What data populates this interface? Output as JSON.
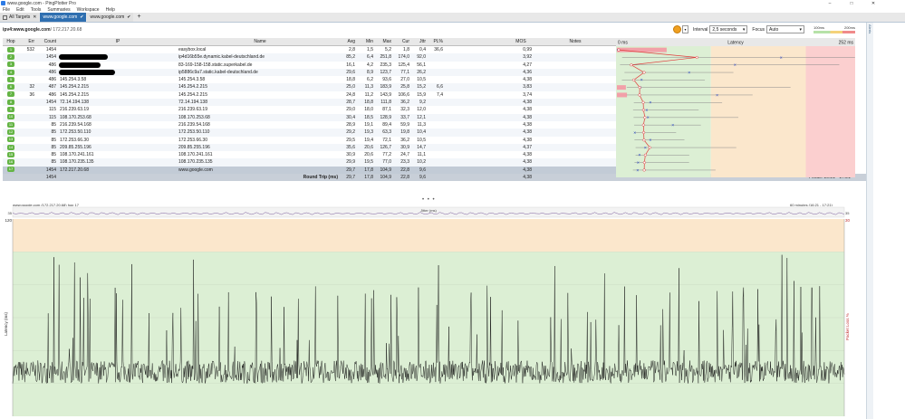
{
  "window": {
    "title": "www.google.com - PingPlotter Pro",
    "controls": [
      "–",
      "□",
      "✕"
    ]
  },
  "menu": [
    "File",
    "Edit",
    "Tools",
    "Summaries",
    "Workspace",
    "Help"
  ],
  "tabs": [
    {
      "label": "All Targets",
      "icon": "✕",
      "active": false
    },
    {
      "label": "www.google.com",
      "icon": "✔",
      "active": true
    },
    {
      "label": "www.google.com",
      "icon": "✔",
      "active": false
    }
  ],
  "add_tab": "+",
  "target": {
    "name": "ipv4:www.google.com",
    "ip": " / 172.217.20.68"
  },
  "controls": {
    "interval_label": "Interval",
    "interval_value": "2,5 seconds",
    "focus_label": "Focus",
    "focus_value": "Auto",
    "threshold_low": "100ms",
    "threshold_high": "200ms"
  },
  "sidebar": {
    "alerts_label": "Alerts"
  },
  "columns": {
    "hop": "Hop",
    "err": "Err",
    "count": "Count",
    "ip": "IP",
    "name": "Name",
    "avg": "Avg",
    "min": "Min",
    "max": "Max",
    "cur": "Cur",
    "jttr": "Jttr",
    "pl": "PL%",
    "mos": "MOS",
    "notes": "Notes",
    "latency": "Latency",
    "latency_min": "0 ms",
    "latency_max": "252 ms"
  },
  "hops": [
    {
      "hop": "1",
      "err": "532",
      "count": "1454",
      "ip": "",
      "name": "easybox.local",
      "avg": "2,8",
      "min": "1,5",
      "max": "5,2",
      "cur": "1,8",
      "jttr": "0,4",
      "pl": "36,6",
      "mos": "0,99"
    },
    {
      "hop": "2",
      "err": "",
      "count": "1454",
      "ip": "",
      "name": "ip4d16b55e.dynamic.kabel-deutschland.de",
      "avg": "85,2",
      "min": "6,4",
      "max": "251,8",
      "cur": "174,0",
      "jttr": "92,0",
      "pl": "",
      "mos": "3,92"
    },
    {
      "hop": "3",
      "err": "",
      "count": "486",
      "ip": "",
      "name": "83-169-158-158.static.superkabel.de",
      "avg": "16,1",
      "min": "4,2",
      "max": "235,3",
      "cur": "125,4",
      "jttr": "56,1",
      "pl": "",
      "mos": "4,27"
    },
    {
      "hop": "4",
      "err": "",
      "count": "486",
      "ip": "",
      "name": "ip5886c9a7.static.kabel-deutschland.de",
      "avg": "29,6",
      "min": "8,9",
      "max": "123,7",
      "cur": "77,1",
      "jttr": "26,2",
      "pl": "",
      "mos": "4,36"
    },
    {
      "hop": "5",
      "err": "",
      "count": "486",
      "ip": "145.254.3.58",
      "name": "145.254.3.58",
      "avg": "18,8",
      "min": "6,2",
      "max": "93,6",
      "cur": "27,0",
      "jttr": "10,5",
      "pl": "",
      "mos": "4,38"
    },
    {
      "hop": "6",
      "err": "32",
      "count": "487",
      "ip": "145.254.2.215",
      "name": "145.254.2.215",
      "avg": "25,0",
      "min": "11,3",
      "max": "183,9",
      "cur": "25,8",
      "jttr": "15,2",
      "pl": "6,6",
      "mos": "3,83"
    },
    {
      "hop": "7",
      "err": "36",
      "count": "486",
      "ip": "145.254.2.215",
      "name": "145.254.2.215",
      "avg": "24,8",
      "min": "11,2",
      "max": "143,9",
      "cur": "106,6",
      "jttr": "15,9",
      "pl": "7,4",
      "mos": "3,74"
    },
    {
      "hop": "8",
      "err": "",
      "count": "1454",
      "ip": "72.14.194.138",
      "name": "72.14.194.138",
      "avg": "28,7",
      "min": "18,8",
      "max": "111,8",
      "cur": "36,2",
      "jttr": "9,2",
      "pl": "",
      "mos": "4,38"
    },
    {
      "hop": "9",
      "err": "",
      "count": "115",
      "ip": "216.239.63.19",
      "name": "216.239.63.19",
      "avg": "29,0",
      "min": "18,0",
      "max": "87,1",
      "cur": "32,3",
      "jttr": "12,0",
      "pl": "",
      "mos": "4,38"
    },
    {
      "hop": "10",
      "err": "",
      "count": "115",
      "ip": "108.170.253.68",
      "name": "108.170.253.68",
      "avg": "30,4",
      "min": "18,5",
      "max": "128,9",
      "cur": "33,7",
      "jttr": "12,1",
      "pl": "",
      "mos": "4,38"
    },
    {
      "hop": "11",
      "err": "",
      "count": "85",
      "ip": "216.239.54.168",
      "name": "216.239.54.168",
      "avg": "28,9",
      "min": "19,1",
      "max": "89,4",
      "cur": "59,9",
      "jttr": "11,3",
      "pl": "",
      "mos": "4,38"
    },
    {
      "hop": "12",
      "err": "",
      "count": "85",
      "ip": "172.253.50.110",
      "name": "172.253.50.110",
      "avg": "29,2",
      "min": "19,3",
      "max": "63,3",
      "cur": "19,8",
      "jttr": "10,4",
      "pl": "",
      "mos": "4,38"
    },
    {
      "hop": "13",
      "err": "",
      "count": "85",
      "ip": "172.253.66.30",
      "name": "172.253.66.30",
      "avg": "29,5",
      "min": "19,4",
      "max": "72,1",
      "cur": "36,2",
      "jttr": "10,5",
      "pl": "",
      "mos": "4,38"
    },
    {
      "hop": "14",
      "err": "",
      "count": "85",
      "ip": "209.85.255.196",
      "name": "209.85.255.196",
      "avg": "35,6",
      "min": "20,6",
      "max": "126,7",
      "cur": "30,9",
      "jttr": "14,7",
      "pl": "",
      "mos": "4,37"
    },
    {
      "hop": "15",
      "err": "",
      "count": "85",
      "ip": "108.170.241.161",
      "name": "108.170.241.161",
      "avg": "30,9",
      "min": "20,6",
      "max": "77,2",
      "cur": "24,7",
      "jttr": "11,1",
      "pl": "",
      "mos": "4,38"
    },
    {
      "hop": "16",
      "err": "",
      "count": "85",
      "ip": "108.170.235.135",
      "name": "108.170.235.135",
      "avg": "29,9",
      "min": "19,5",
      "max": "77,0",
      "cur": "23,3",
      "jttr": "10,2",
      "pl": "",
      "mos": "4,38"
    },
    {
      "hop": "17",
      "err": "",
      "count": "1454",
      "ip": "172.217.20.68",
      "name": "www.google.com",
      "avg": "29,7",
      "min": "17,8",
      "max": "104,9",
      "cur": "22,8",
      "jttr": "9,6",
      "pl": "",
      "mos": "4,38"
    }
  ],
  "total": {
    "count": "1454",
    "label": "Round Trip (ms)",
    "avg": "29,7",
    "min": "17,8",
    "max": "104,9",
    "cur": "22,8",
    "jttr": "9,6",
    "mos": "4,38"
  },
  "focus_range": "Focus: 16:21 - 17:21",
  "resize_handle": "• • •",
  "graph": {
    "title": "www.google.com (172.217.20.68) hop 17",
    "range": "60 minutes (16:21 - 17:21)",
    "jitter_label": "Jitter (ms)",
    "y_label": "Latency (ms)",
    "y_right_label": "Packet Loss %",
    "y_top_left": "120",
    "y_top_right": "30",
    "jitter_left": "35",
    "jitter_right": "35"
  },
  "colors": {
    "tab_active": "#2f6fb0",
    "hop_badge": "#64b445",
    "zone_green": "#dcefd4",
    "zone_yellow": "#fbe7cc",
    "zone_red": "#fbcfcf",
    "trace_red": "#e03c3c",
    "loss_bar": "#f2a0a8"
  }
}
